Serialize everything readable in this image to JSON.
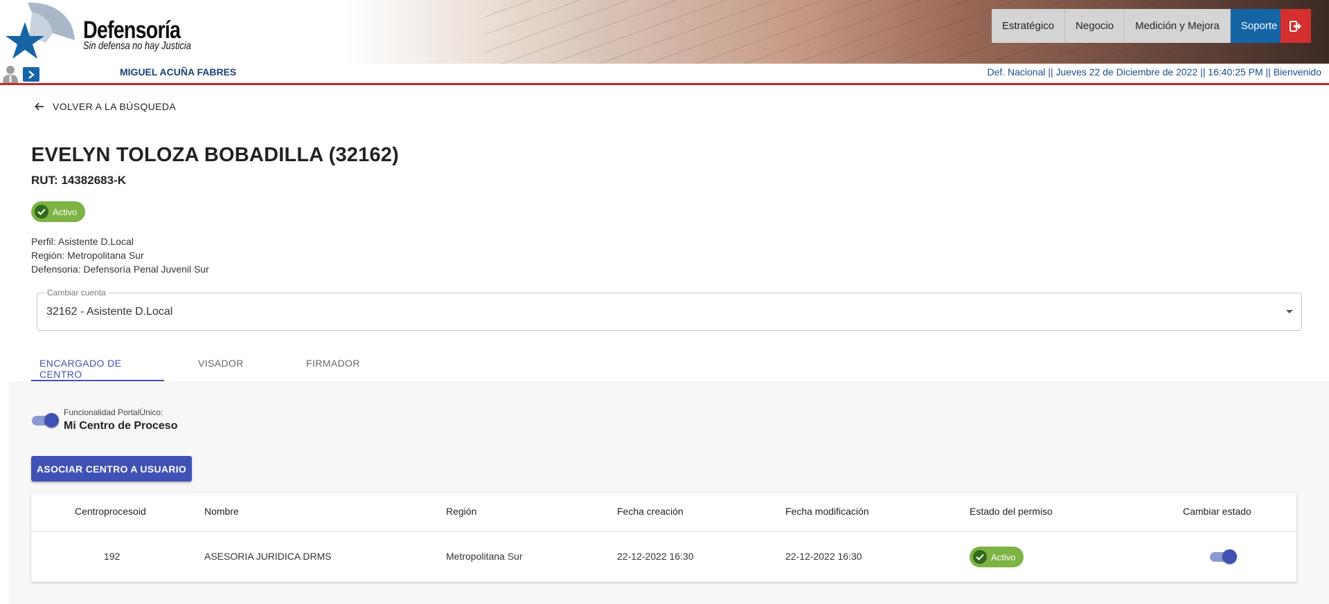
{
  "header": {
    "logo_title": "Defensoría",
    "logo_subtitle": "Sin defensa no hay Justicia",
    "nav": [
      "Estratégico",
      "Negocio",
      "Medición y Mejora",
      "Soporte"
    ],
    "active_nav": "Soporte",
    "logout_icon": "logout-icon"
  },
  "infobar": {
    "user_name": "MIGUEL ACUÑA FABRES",
    "status": "Def. Nacional || Jueves 22 de Diciembre de 2022 || 16:40:25 PM || Bienvenido"
  },
  "back": {
    "label": "VOLVER A LA BÚSQUEDA"
  },
  "person": {
    "title": "EVELYN TOLOZA BOBADILLA (32162)",
    "rut": "RUT: 14382683-K",
    "status": "Activo",
    "perfil": "Perfil: Asistente D.Local",
    "region": "Región: Metropolitana Sur",
    "defensoria": "Defensoria: Defensoría Penal Juvenil Sur"
  },
  "account_select": {
    "label": "Cambiar cuenta",
    "value": "32162 - Asistente D.Local"
  },
  "tabs": [
    "ENCARGADO DE CENTRO",
    "VISADOR",
    "FIRMADOR"
  ],
  "active_tab": "ENCARGADO DE CENTRO",
  "panel": {
    "func_label": "Funcionalidad PortalÚnico:",
    "func_name": "Mi Centro de Proceso",
    "func_enabled": true,
    "assoc_button": "ASOCIAR CENTRO A USUARIO"
  },
  "table": {
    "columns": [
      "Centroprocesoid",
      "Nombre",
      "Región",
      "Fecha creación",
      "Fecha modificación",
      "Estado del permiso",
      "Cambiar estado"
    ],
    "rows": [
      {
        "id": "192",
        "nombre": "ASESORIA JURIDICA DRMS",
        "region": "Metropolitana Sur",
        "fecha_creacion": "22-12-2022 16:30",
        "fecha_modificacion": "22-12-2022 16:30",
        "estado": "Activo",
        "toggle_on": true
      }
    ]
  },
  "colors": {
    "primary": "#3f51b5",
    "nav_active": "#1565a6",
    "logout": "#d32f2f",
    "active_chip": "#7cb342",
    "infobar_border": "#c62828"
  }
}
